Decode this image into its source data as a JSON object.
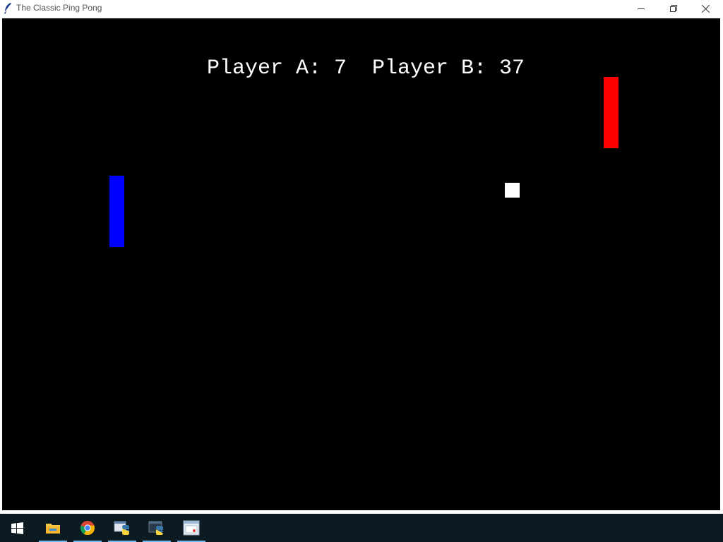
{
  "window": {
    "title": "The Classic Ping Pong",
    "icon": "feather-icon",
    "controls": [
      "minimize-icon",
      "restore-icon",
      "close-icon"
    ]
  },
  "game": {
    "background_color": "#000000",
    "score_text": "Player A: 7  Player B: 37",
    "player_a": {
      "label": "Player A",
      "score": 7,
      "paddle_color": "#0000ff"
    },
    "player_b": {
      "label": "Player B",
      "score": 37,
      "paddle_color": "#ff0000"
    },
    "ball_color": "#ffffff",
    "text_color": "#ffffff"
  },
  "taskbar": {
    "background_color": "#0c1a22",
    "accent_color": "#76b9ed",
    "items": [
      {
        "name": "start-button",
        "icon": "windows-logo-icon"
      },
      {
        "name": "file-explorer",
        "icon": "folder-icon",
        "active": true
      },
      {
        "name": "chrome",
        "icon": "chrome-icon",
        "active": true
      },
      {
        "name": "idle",
        "icon": "python-idle-icon",
        "active": true
      },
      {
        "name": "python",
        "icon": "python-icon",
        "active": true
      },
      {
        "name": "tk-app",
        "icon": "tk-window-icon",
        "active": true
      }
    ]
  }
}
